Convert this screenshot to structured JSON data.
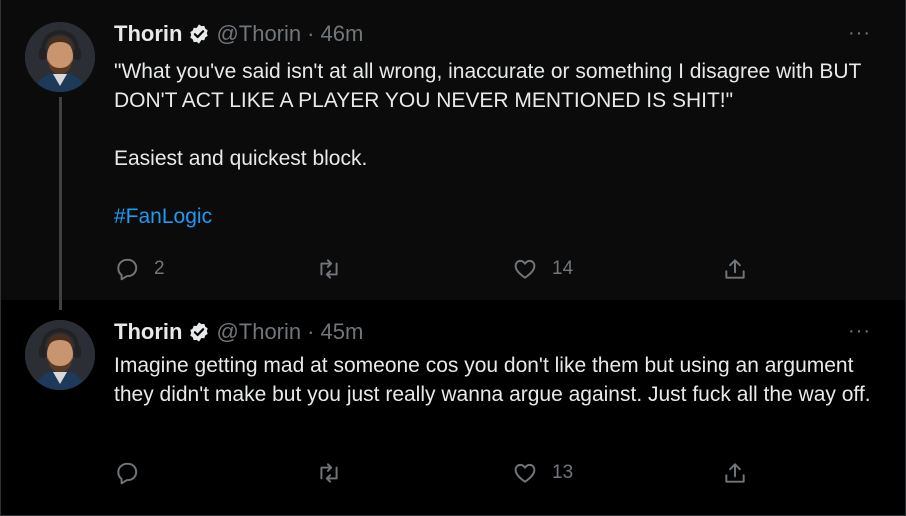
{
  "tweets": [
    {
      "author_name": "Thorin",
      "handle": "@Thorin",
      "separator": "·",
      "time": "46m",
      "paragraphs": [
        "\"What you've said isn't at all wrong, inaccurate or something I disagree with BUT DON'T ACT LIKE A PLAYER YOU NEVER MENTIONED IS SHIT!\"",
        "Easiest and quickest block."
      ],
      "hashtag": "#FanLogic",
      "reply_count": "2",
      "retweet_count": "",
      "like_count": "14"
    },
    {
      "author_name": "Thorin",
      "handle": "@Thorin",
      "separator": "·",
      "time": "45m",
      "paragraphs": [
        "Imagine getting mad at someone cos you don't like them but using an argument they didn't make but you just really wanna argue against.  Just fuck all the way off."
      ],
      "reply_count": "",
      "retweet_count": "",
      "like_count": "13"
    }
  ],
  "more_label": "···",
  "colors": {
    "background": "#000000",
    "highlight_background": "#0b0b0b",
    "text": "#e7e9ea",
    "muted": "#71767b",
    "link": "#1d9bf0"
  },
  "icons": [
    "verified-badge-icon",
    "reply-icon",
    "retweet-icon",
    "like-icon",
    "share-icon",
    "more-icon"
  ]
}
